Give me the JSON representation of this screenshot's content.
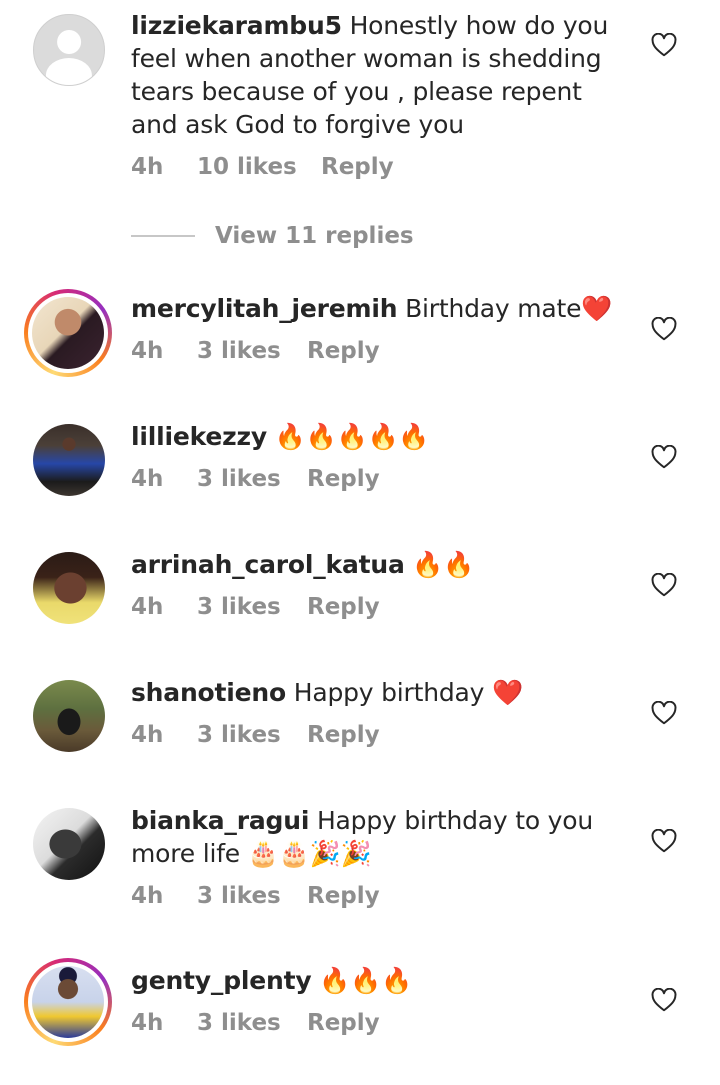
{
  "colors": {
    "text": "#262626",
    "muted": "#8e8e8e",
    "heart_red": "#e0245e",
    "fire": "#f4900c"
  },
  "comments": [
    {
      "username": "lizziekarambu5",
      "text": "Honestly how do you feel when another woman is shedding tears because of you , please repent and ask God to forgive you",
      "time": "4h",
      "likes": "10 likes",
      "reply": "Reply",
      "avatar": "default-avatar-icon"
    },
    {
      "username": "mercylitah_jeremih",
      "text": "Birthday mate❤️",
      "time": "4h",
      "likes": "3 likes",
      "reply": "Reply",
      "avatar": "profile-photo"
    },
    {
      "username": "lilliekezzy",
      "text": "🔥🔥🔥🔥🔥",
      "time": "4h",
      "likes": "3 likes",
      "reply": "Reply",
      "avatar": "profile-photo"
    },
    {
      "username": "arrinah_carol_katua",
      "text": "🔥🔥",
      "time": "4h",
      "likes": "3 likes",
      "reply": "Reply",
      "avatar": "profile-photo"
    },
    {
      "username": "shanotieno",
      "text": "Happy birthday ❤️",
      "time": "4h",
      "likes": "3 likes",
      "reply": "Reply",
      "avatar": "profile-photo"
    },
    {
      "username": "bianka_ragui",
      "text": "Happy birthday to you more life 🎂🎂🎉🎉",
      "time": "4h",
      "likes": "3 likes",
      "reply": "Reply",
      "avatar": "profile-photo"
    },
    {
      "username": "genty_plenty",
      "text": "🔥🔥🔥",
      "time": "4h",
      "likes": "3 likes",
      "reply": "Reply",
      "avatar": "profile-photo"
    }
  ],
  "view_replies": "View 11 replies"
}
